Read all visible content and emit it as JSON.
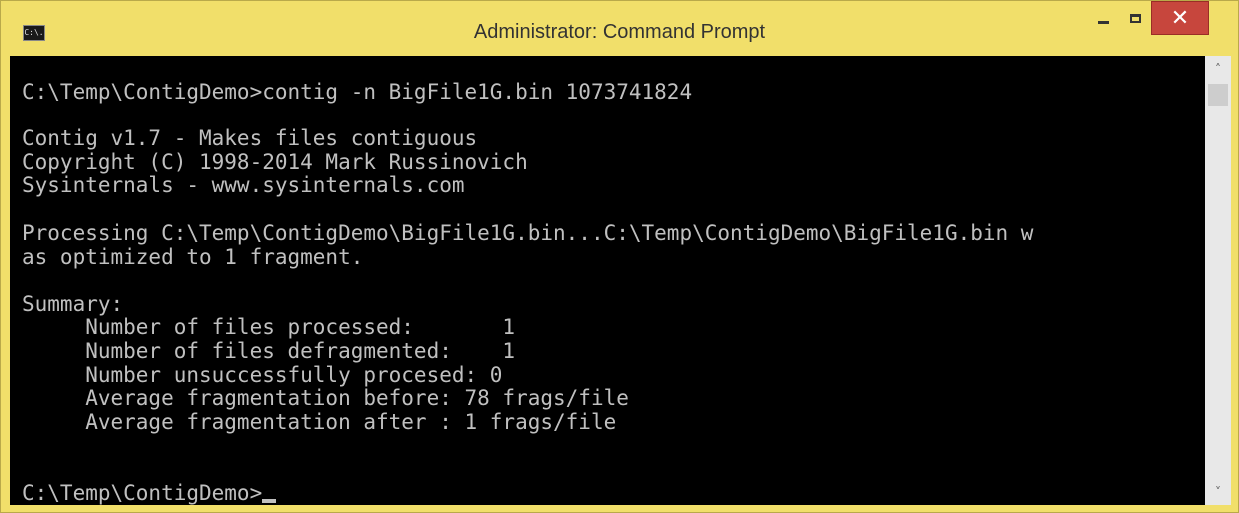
{
  "window": {
    "title": "Administrator: Command Prompt",
    "icon_label": "C:\\.",
    "close_label": "✕"
  },
  "console": {
    "lines": [
      "C:\\Temp\\ContigDemo>contig -n BigFile1G.bin 1073741824",
      "Contig v1.7 - Makes files contiguous",
      "Copyright (C) 1998-2014 Mark Russinovich",
      "Sysinternals - www.sysinternals.com",
      "Processing C:\\Temp\\ContigDemo\\BigFile1G.bin...C:\\Temp\\ContigDemo\\BigFile1G.bin w",
      "as optimized to 1 fragment.",
      "Summary:",
      "     Number of files processed:       1",
      "     Number of files defragmented:    1",
      "     Number unsuccessfully procesed: 0",
      "     Average fragmentation before: 78 frags/file",
      "     Average fragmentation after : 1 frags/file"
    ],
    "prompt": "C:\\Temp\\ContigDemo>"
  },
  "scrollbar": {
    "up_arrow": "˄",
    "down_arrow": "˅"
  }
}
